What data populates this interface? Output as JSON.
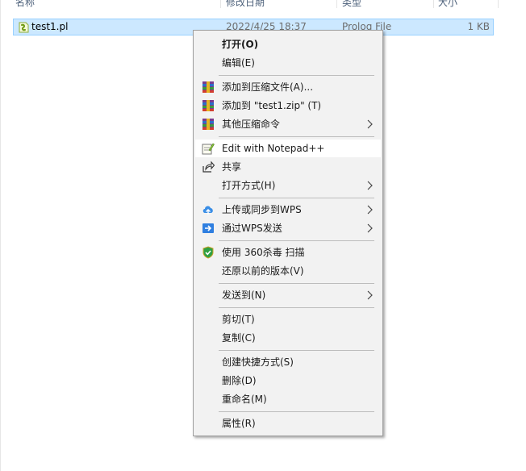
{
  "header": {
    "name": "名称",
    "date": "修改日期",
    "type": "类型",
    "size": "大小"
  },
  "file": {
    "name": "test1.pl",
    "date": "2022/4/25 18:37",
    "type": "Prolog File",
    "size": "1 KB"
  },
  "menu": {
    "open": "打开(O)",
    "edit": "编辑(E)",
    "add_archive": "添加到压缩文件(A)...",
    "add_zip": "添加到 \"test1.zip\" (T)",
    "other_compress": "其他压缩命令",
    "notepadpp": "Edit with Notepad++",
    "share": "共享",
    "open_with": "打开方式(H)",
    "wps_upload": "上传或同步到WPS",
    "wps_send": "通过WPS发送",
    "scan_360": "使用 360杀毒 扫描",
    "restore": "还原以前的版本(V)",
    "send_to": "发送到(N)",
    "cut": "剪切(T)",
    "copy": "复制(C)",
    "shortcut": "创建快捷方式(S)",
    "delete": "删除(D)",
    "rename": "重命名(M)",
    "properties": "属性(R)"
  },
  "colors": {
    "selection": "#cce8ff",
    "selection_border": "#99d1ff",
    "menu_bg": "#f2f2f2",
    "header_text": "#4c607a"
  }
}
